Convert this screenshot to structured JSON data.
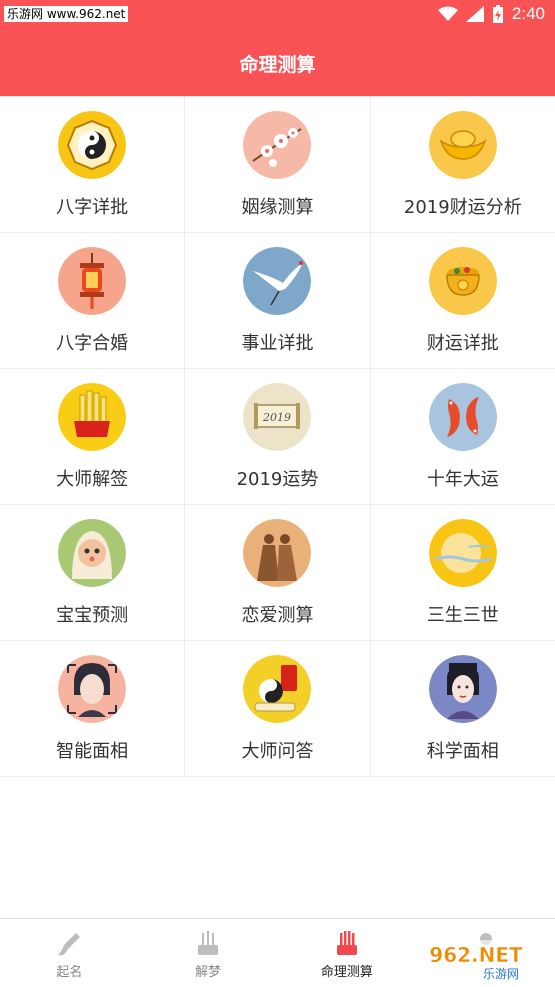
{
  "status_bar": {
    "site": "乐游网 www.962.net",
    "time": "2:40"
  },
  "header": {
    "title": "命理测算"
  },
  "grid": [
    {
      "label": "八字详批",
      "icon": "bagua-icon"
    },
    {
      "label": "姻缘测算",
      "icon": "plum-blossom-icon"
    },
    {
      "label": "2019财运分析",
      "icon": "gold-ingot-icon"
    },
    {
      "label": "八字合婚",
      "icon": "lantern-icon"
    },
    {
      "label": "事业详批",
      "icon": "crane-icon"
    },
    {
      "label": "财运详批",
      "icon": "treasure-bowl-icon"
    },
    {
      "label": "大师解签",
      "icon": "fortune-sticks-icon"
    },
    {
      "label": "2019运势",
      "icon": "scroll-2019-icon"
    },
    {
      "label": "十年大运",
      "icon": "koi-fish-icon"
    },
    {
      "label": "宝宝预测",
      "icon": "baby-icon"
    },
    {
      "label": "恋爱测算",
      "icon": "couple-icon"
    },
    {
      "label": "三生三世",
      "icon": "moon-icon"
    },
    {
      "label": "智能面相",
      "icon": "face-scan-icon"
    },
    {
      "label": "大师问答",
      "icon": "taiji-scroll-icon"
    },
    {
      "label": "科学面相",
      "icon": "lady-portrait-icon"
    }
  ],
  "tabs": [
    {
      "label": "起名",
      "icon": "brush-icon",
      "active": false
    },
    {
      "label": "解梦",
      "icon": "incense-icon",
      "active": false
    },
    {
      "label": "命理测算",
      "icon": "sticks-icon",
      "active": true
    },
    {
      "label": "",
      "icon": "more-icon",
      "active": false
    }
  ],
  "watermark": {
    "text": "962.NET",
    "subtext": "乐游网"
  },
  "colors": {
    "accent": "#f95356",
    "text": "#333333"
  }
}
